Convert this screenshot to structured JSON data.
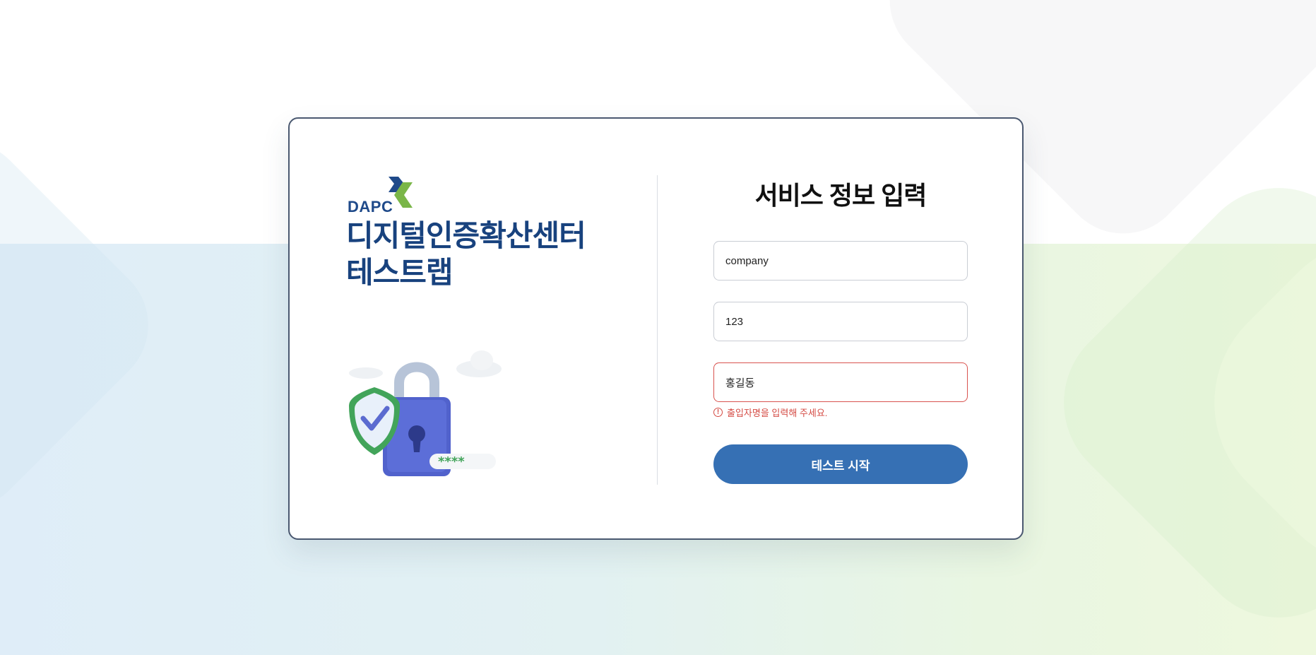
{
  "brand": {
    "logo_text": "DAPC",
    "title_line1": "디지털인증확산센터",
    "title_line2": "테스트랩"
  },
  "form": {
    "title": "서비스 정보 입력",
    "fields": [
      {
        "value": "company",
        "placeholder": ""
      },
      {
        "value": "123",
        "placeholder": ""
      },
      {
        "value": "홍길동",
        "placeholder": ""
      }
    ],
    "error_message": "출입자명을 입력해 주세요.",
    "submit_label": "테스트 시작"
  },
  "colors": {
    "brand_navy": "#1f4a8a",
    "brand_green": "#7ab648",
    "button": "#3670b4",
    "error": "#d44a43",
    "card_border": "#4a5870"
  },
  "icons": {
    "logo": "dapc-arrow-logo",
    "illustration": "padlock-shield-illustration",
    "error": "exclamation-circle-icon"
  }
}
